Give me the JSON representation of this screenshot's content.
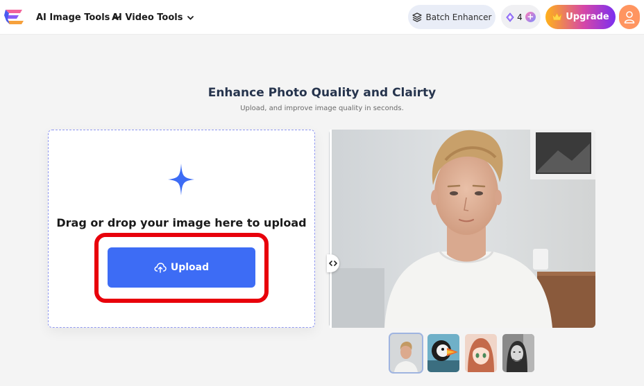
{
  "header": {
    "nav": [
      {
        "label": "AI Image Tools"
      },
      {
        "label": "AI Video Tools"
      }
    ],
    "batch_label": "Batch Enhancer",
    "credits_count": "4",
    "upgrade_label": "Upgrade"
  },
  "main": {
    "title": "Enhance Photo Quality and Clairty",
    "subtitle": "Upload, and improve image quality in seconds.",
    "drop_text": "Drag or drop your image here to upload",
    "upload_label": "Upload"
  },
  "colors": {
    "accent_blue": "#3d6cf5",
    "highlight_red": "#e8000b",
    "upgrade_gradient": [
      "#ffb21a",
      "#d546a8",
      "#7b2ff0"
    ],
    "avatar_bg": "#ff9560"
  },
  "icons": {
    "logo": "brand-logo-icon",
    "chevron": "chevron-down-icon",
    "batch": "layers-icon",
    "credits": "gem-icon",
    "plus": "plus-icon",
    "upgrade": "crown-icon",
    "avatar": "user-icon",
    "sparkle": "sparkle-icon",
    "upload": "cloud-upload-icon",
    "compare": "compare-arrows-icon"
  },
  "thumbnails": [
    {
      "name": "young-man-portrait",
      "selected": true
    },
    {
      "name": "puffin-bird",
      "selected": false
    },
    {
      "name": "anime-girl",
      "selected": false
    },
    {
      "name": "bw-woman-portrait",
      "selected": false
    }
  ]
}
